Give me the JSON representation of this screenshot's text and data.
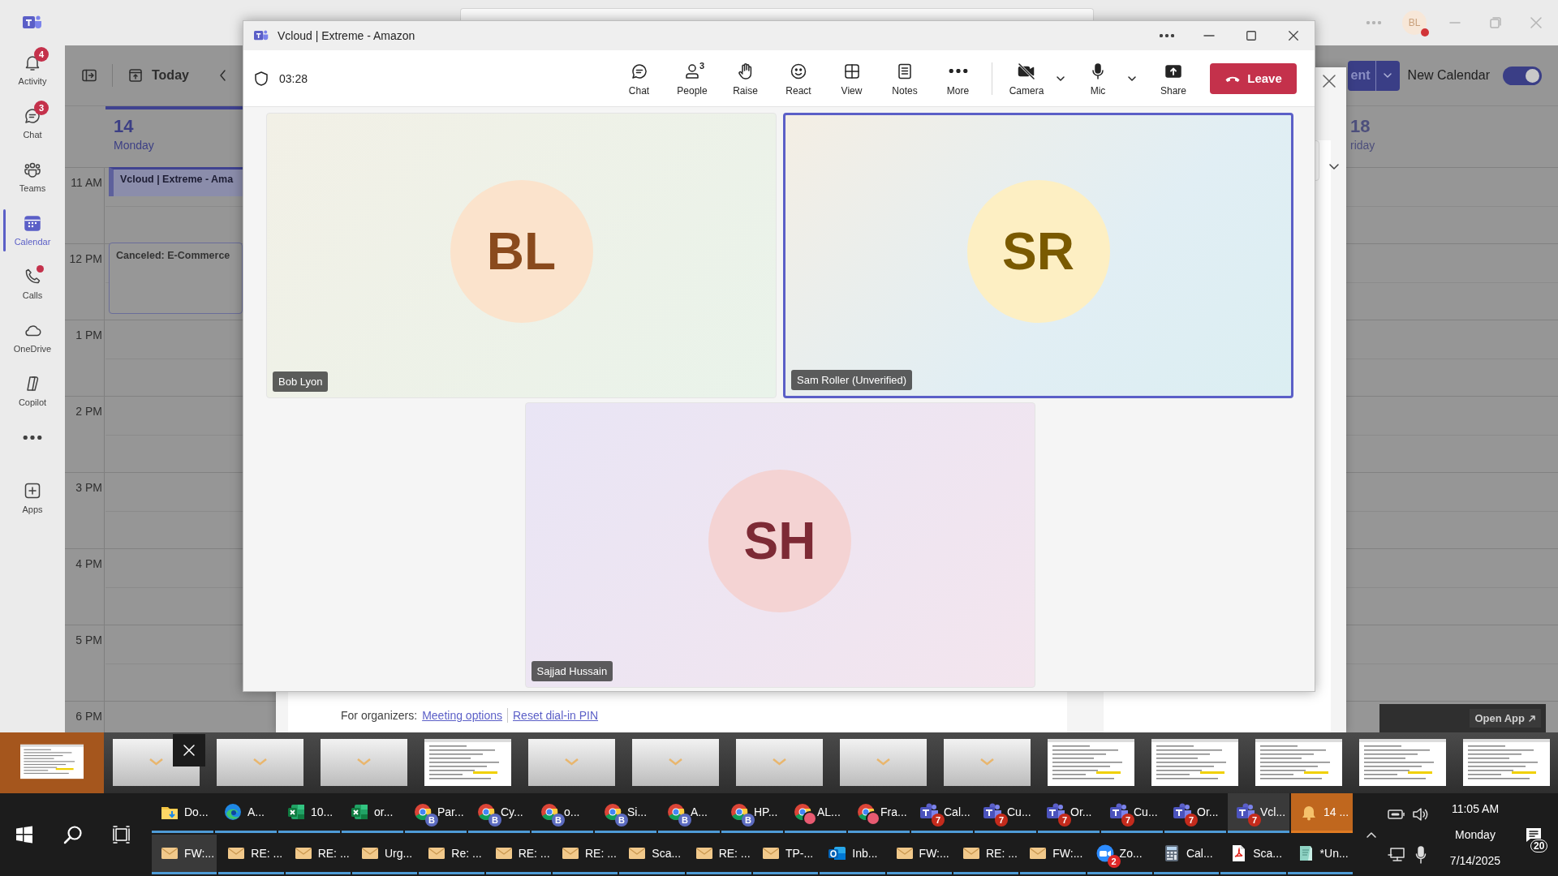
{
  "teams": {
    "title_bar": {
      "avatar": "BL"
    },
    "rail": [
      {
        "label": "Activity",
        "badge": "4",
        "dot": false,
        "selected": false
      },
      {
        "label": "Chat",
        "badge": "3",
        "dot": false,
        "selected": false
      },
      {
        "label": "Teams",
        "dot": false,
        "selected": false
      },
      {
        "label": "Calendar",
        "dot": false,
        "selected": true
      },
      {
        "label": "Calls",
        "dot": true,
        "selected": false
      },
      {
        "label": "OneDrive",
        "dot": false,
        "selected": false
      },
      {
        "label": "Copilot",
        "dot": false,
        "selected": false
      },
      {
        "dot": false,
        "selected": false
      },
      {
        "label": "Apps",
        "dot": false,
        "selected": false
      }
    ],
    "calendar": {
      "today_label": "Today",
      "new_event_label": "ent",
      "new_calendar": {
        "label": "New Calendar",
        "on": true
      },
      "days": [
        {
          "date": "14",
          "weekday": "Monday",
          "today": true
        },
        {
          "date": "18",
          "weekday": "riday",
          "today": false
        }
      ],
      "hours": [
        "11 AM",
        "12 PM",
        "1 PM",
        "2 PM",
        "3 PM",
        "4 PM",
        "5 PM",
        "6 PM"
      ],
      "events": [
        {
          "title": "Vcloud | Extreme - Ama",
          "kind": "meeting"
        },
        {
          "title": "Canceled: E-Commerce",
          "kind": "canceled"
        }
      ]
    },
    "dialog": {
      "footer_prefix": "For organizers:",
      "links": [
        "Meeting options",
        "Reset dial-in PIN"
      ]
    },
    "open_app": "Open App"
  },
  "meeting": {
    "title": "Vcloud | Extreme - Amazon",
    "timer": "03:28",
    "actions": [
      {
        "label": "Chat"
      },
      {
        "label": "People",
        "count": "3"
      },
      {
        "label": "Raise"
      },
      {
        "label": "React"
      },
      {
        "label": "View"
      },
      {
        "label": "Notes"
      },
      {
        "label": "More"
      }
    ],
    "camera": {
      "label": "Camera",
      "on": false
    },
    "mic": {
      "label": "Mic",
      "on": true
    },
    "share": {
      "label": "Share"
    },
    "leave": "Leave",
    "participants": [
      {
        "initials": "BL",
        "name": "Bob Lyon",
        "color": "#fbe3cc",
        "selected": false
      },
      {
        "initials": "SR",
        "name": "Sam Roller (Unverified)",
        "color": "#fdefc3",
        "selected": true
      },
      {
        "initials": "SH",
        "name": "Sajjad Hussain",
        "color": "#f4d3d3",
        "selected": false
      }
    ]
  },
  "thumbnails": [
    {
      "kind": "document",
      "selected": true,
      "hovered": false
    },
    {
      "kind": "mail",
      "selected": false,
      "hovered": true
    },
    {
      "kind": "mail",
      "selected": false,
      "hovered": false
    },
    {
      "kind": "mail",
      "selected": false,
      "hovered": false
    },
    {
      "kind": "document",
      "selected": false,
      "hovered": false
    },
    {
      "kind": "mail",
      "selected": false,
      "hovered": false
    },
    {
      "kind": "mail",
      "selected": false,
      "hovered": false
    },
    {
      "kind": "mail",
      "selected": false,
      "hovered": false
    },
    {
      "kind": "mail",
      "selected": false,
      "hovered": false
    },
    {
      "kind": "mail",
      "selected": false,
      "hovered": false
    },
    {
      "kind": "document",
      "selected": false,
      "hovered": false
    },
    {
      "kind": "document",
      "selected": false,
      "hovered": false
    },
    {
      "kind": "document",
      "selected": false,
      "hovered": false
    },
    {
      "kind": "document",
      "selected": false,
      "hovered": false
    },
    {
      "kind": "document",
      "selected": false,
      "hovered": false
    }
  ],
  "taskbar": {
    "upper_apps": [
      {
        "label": "Do...",
        "kind": "folder",
        "active": false,
        "flashing": false
      },
      {
        "label": "A...",
        "kind": "edge",
        "active": false,
        "flashing": false
      },
      {
        "label": "10...",
        "kind": "excel",
        "active": false,
        "flashing": false
      },
      {
        "label": "or...",
        "kind": "excel",
        "active": false,
        "flashing": false
      },
      {
        "label": "Par...",
        "kind": "chrome",
        "badge": "B",
        "active": false,
        "flashing": false
      },
      {
        "label": "Cy...",
        "kind": "chrome",
        "badge": "B",
        "active": false,
        "flashing": false
      },
      {
        "label": "o...",
        "kind": "chrome",
        "badge": "B",
        "active": false,
        "flashing": false
      },
      {
        "label": "Si...",
        "kind": "chrome",
        "badge": "B",
        "active": false,
        "flashing": false
      },
      {
        "label": "A...",
        "kind": "chrome",
        "badge": "B",
        "active": false,
        "flashing": false
      },
      {
        "label": "HP...",
        "kind": "chrome",
        "badge": "B",
        "active": false,
        "flashing": false
      },
      {
        "label": "AL...",
        "kind": "chrome-profile",
        "active": false,
        "flashing": false
      },
      {
        "label": "Fra...",
        "kind": "chrome-profile",
        "active": false,
        "flashing": false
      },
      {
        "label": "Cal...",
        "kind": "teams",
        "badge": "7",
        "active": false,
        "flashing": false
      },
      {
        "label": "Cu...",
        "kind": "teams",
        "badge": "7",
        "active": false,
        "flashing": false
      },
      {
        "label": "Or...",
        "kind": "teams",
        "badge": "7",
        "active": false,
        "flashing": false
      },
      {
        "label": "Cu...",
        "kind": "teams",
        "badge": "7",
        "active": false,
        "flashing": false
      },
      {
        "label": "Or...",
        "kind": "teams",
        "badge": "7",
        "active": false,
        "flashing": false
      },
      {
        "label": "Vcl...",
        "kind": "teams",
        "badge": "7",
        "active": true,
        "flashing": false
      },
      {
        "label": "14 ...",
        "kind": "bell",
        "active": false,
        "flashing": true
      }
    ],
    "lower_apps": [
      {
        "label": "FW:...",
        "kind": "mail",
        "active": true,
        "flashing": false
      },
      {
        "label": "RE: ...",
        "kind": "mail",
        "active": false,
        "flashing": false
      },
      {
        "label": "RE: ...",
        "kind": "mail",
        "active": false,
        "flashing": false
      },
      {
        "label": "Urg...",
        "kind": "mail",
        "active": false,
        "flashing": false
      },
      {
        "label": "Re: ...",
        "kind": "mail",
        "active": false,
        "flashing": false
      },
      {
        "label": "RE: ...",
        "kind": "mail",
        "active": false,
        "flashing": false
      },
      {
        "label": "RE: ...",
        "kind": "mail",
        "active": false,
        "flashing": false
      },
      {
        "label": "Sca...",
        "kind": "mail",
        "active": false,
        "flashing": false
      },
      {
        "label": "RE: ...",
        "kind": "mail",
        "active": false,
        "flashing": false
      },
      {
        "label": "TP-...",
        "kind": "mail",
        "active": false,
        "flashing": false
      },
      {
        "label": "Inb...",
        "kind": "outlook",
        "active": false,
        "flashing": false
      },
      {
        "label": "FW:...",
        "kind": "mail",
        "active": false,
        "flashing": false
      },
      {
        "label": "RE: ...",
        "kind": "mail",
        "active": false,
        "flashing": false
      },
      {
        "label": "FW:...",
        "kind": "mail",
        "active": false,
        "flashing": false
      },
      {
        "label": "Zo...",
        "kind": "zoom",
        "badge": "2",
        "active": false,
        "flashing": false
      },
      {
        "label": "Cal...",
        "kind": "calculator",
        "active": false,
        "flashing": false
      },
      {
        "label": "Sca...",
        "kind": "pdf",
        "active": false,
        "flashing": false
      },
      {
        "label": "*Un...",
        "kind": "notepad",
        "active": false,
        "flashing": false
      }
    ],
    "tray": {
      "time": "11:05 AM",
      "day": "Monday",
      "date": "7/14/2025",
      "notifications": "20"
    }
  }
}
